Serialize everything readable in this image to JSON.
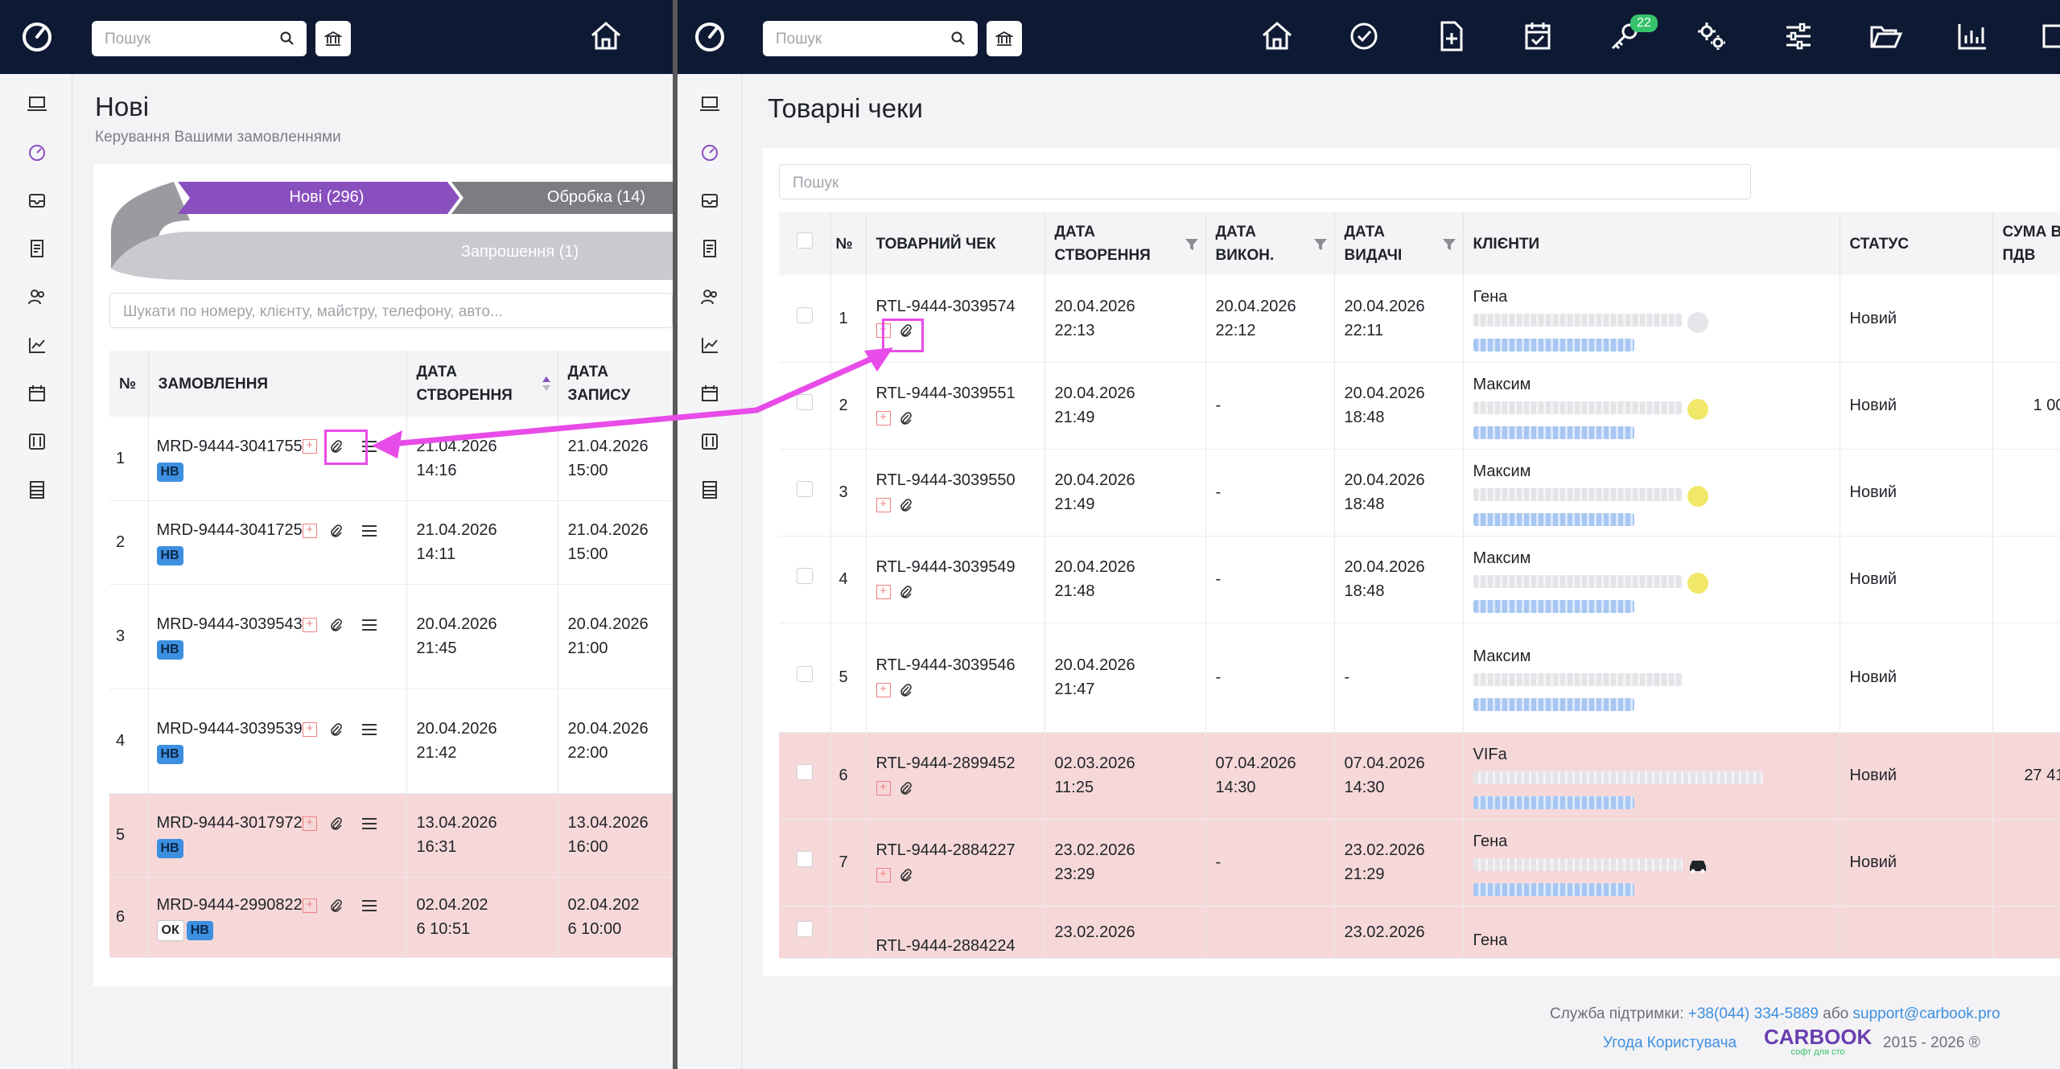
{
  "left": {
    "search": {
      "placeholder": "Пошук"
    },
    "title": "Нові",
    "subtitle": "Керування Вашими замовленнями",
    "pipeline": {
      "tab_new": "Нові  (296)",
      "tab_processing": "Обробка  (14)",
      "tab_invitation": "Запрошення  (1)"
    },
    "filter_placeholder": "Шукати по номеру, клієнту, майстру, телефону, авто...",
    "columns": {
      "num": "№",
      "order": "ЗАМОВЛЕННЯ",
      "created_1": "ДАТА",
      "created_2": "СТВОРЕННЯ",
      "record_1": "ДАТА",
      "record_2": "ЗАПИСУ"
    },
    "rows": [
      {
        "n": "1",
        "order": "MRD-9444-3041755",
        "badges": [
          "НВ"
        ],
        "created_1": "21.04.2026",
        "created_2": "14:16",
        "record_1": "21.04.2026",
        "record_2": "15:00",
        "pink": false
      },
      {
        "n": "2",
        "order": "MRD-9444-3041725",
        "badges": [
          "НВ"
        ],
        "created_1": "21.04.2026",
        "created_2": "14:11",
        "record_1": "21.04.2026",
        "record_2": "15:00",
        "pink": false
      },
      {
        "n": "3",
        "order": "MRD-9444-3039543",
        "badges": [
          "НВ"
        ],
        "created_1": "20.04.2026",
        "created_2": "21:45",
        "record_1": "20.04.2026",
        "record_2": "21:00",
        "pink": false
      },
      {
        "n": "4",
        "order": "MRD-9444-3039539",
        "badges": [
          "НВ"
        ],
        "created_1": "20.04.2026",
        "created_2": "21:42",
        "record_1": "20.04.2026",
        "record_2": "22:00",
        "pink": false
      },
      {
        "n": "5",
        "order": "MRD-9444-3017972",
        "badges": [
          "НВ"
        ],
        "created_1": "13.04.2026",
        "created_2": "16:31",
        "record_1": "13.04.2026",
        "record_2": "16:00",
        "pink": true
      },
      {
        "n": "6",
        "order": "MRD-9444-2990822",
        "badges": [
          "ОК",
          "НВ"
        ],
        "created_1": "02.04.202",
        "created_2": "6 10:51",
        "record_1": "02.04.202",
        "record_2": "6 10:00",
        "pink": true
      }
    ]
  },
  "right": {
    "search": {
      "placeholder": "Пошук"
    },
    "notification_count": "22",
    "title": "Товарні чеки",
    "filter_placeholder": "Пошук",
    "columns": {
      "num": "№",
      "receipt": "ТОВАРНИЙ ЧЕК",
      "created_1": "ДАТА",
      "created_2": "СТВОРЕННЯ",
      "done_1": "ДАТА",
      "done_2": "ВИКОН.",
      "issued_1": "ДАТА",
      "issued_2": "ВИДАЧІ",
      "clients": "КЛІЄНТИ",
      "status": "СТАТУС",
      "sum_1": "СУМА В",
      "sum_2": "ПДВ"
    },
    "rows": [
      {
        "n": "1",
        "receipt": "RTL-9444-3039574",
        "created_1": "20.04.2026",
        "created_2": "22:13",
        "done_1": "20.04.2026",
        "done_2": "22:12",
        "issued_1": "20.04.2026",
        "issued_2": "22:11",
        "client": "Гена",
        "status": "Новий",
        "sum": "",
        "pink": false,
        "dot": "grey"
      },
      {
        "n": "2",
        "receipt": "RTL-9444-3039551",
        "created_1": "20.04.2026",
        "created_2": "21:49",
        "done_1": "-",
        "done_2": "",
        "issued_1": "20.04.2026",
        "issued_2": "18:48",
        "client": "Максим",
        "status": "Новий",
        "sum": "1 00",
        "pink": false,
        "dot": "yellow"
      },
      {
        "n": "3",
        "receipt": "RTL-9444-3039550",
        "created_1": "20.04.2026",
        "created_2": "21:49",
        "done_1": "-",
        "done_2": "",
        "issued_1": "20.04.2026",
        "issued_2": "18:48",
        "client": "Максим",
        "status": "Новий",
        "sum": "",
        "pink": false,
        "dot": "yellow"
      },
      {
        "n": "4",
        "receipt": "RTL-9444-3039549",
        "created_1": "20.04.2026",
        "created_2": "21:48",
        "done_1": "-",
        "done_2": "",
        "issued_1": "20.04.2026",
        "issued_2": "18:48",
        "client": "Максим",
        "status": "Новий",
        "sum": "",
        "pink": false,
        "dot": "yellow"
      },
      {
        "n": "5",
        "receipt": "RTL-9444-3039546",
        "created_1": "20.04.2026",
        "created_2": "21:47",
        "done_1": "-",
        "done_2": "",
        "issued_1": "-",
        "issued_2": "",
        "client": "Максим",
        "status": "Новий",
        "sum": "",
        "pink": false,
        "dot": ""
      },
      {
        "n": "6",
        "receipt": "RTL-9444-2899452",
        "created_1": "02.03.2026",
        "created_2": "11:25",
        "done_1": "07.04.2026",
        "done_2": "14:30",
        "issued_1": "07.04.2026",
        "issued_2": "14:30",
        "client": "VIFa",
        "status": "Новий",
        "sum": "27 41",
        "pink": true,
        "dot": ""
      },
      {
        "n": "7",
        "receipt": "RTL-9444-2884227",
        "created_1": "23.02.2026",
        "created_2": "23:29",
        "done_1": "-",
        "done_2": "",
        "issued_1": "23.02.2026",
        "issued_2": "21:29",
        "client": "Гена",
        "status": "Новий",
        "sum": "",
        "pink": true,
        "dot": "car"
      },
      {
        "n": "",
        "receipt": "RTL-9444-2884224",
        "created_1": "23.02.2026",
        "created_2": "",
        "done_1": "",
        "done_2": "",
        "issued_1": "23.02.2026",
        "issued_2": "",
        "client": "Гена",
        "status": "",
        "sum": "",
        "pink": true,
        "dot": ""
      }
    ],
    "footer": {
      "support_label": "Служба підтримки:",
      "phone": "+38(044) 334-5889",
      "or": "або",
      "email": "support@carbook.pro",
      "agreement": "Угода Користувача",
      "brand": "CARBOOK",
      "brand_tagline": "софт для сто",
      "years": "2015 - 2026 ®"
    }
  },
  "colors": {
    "topbar": "#0e1a33",
    "accent_purple": "#8a4fbf",
    "annotation": "#e84ce8",
    "link": "#3d8fe0",
    "pink_row": "#f6d8d9"
  }
}
